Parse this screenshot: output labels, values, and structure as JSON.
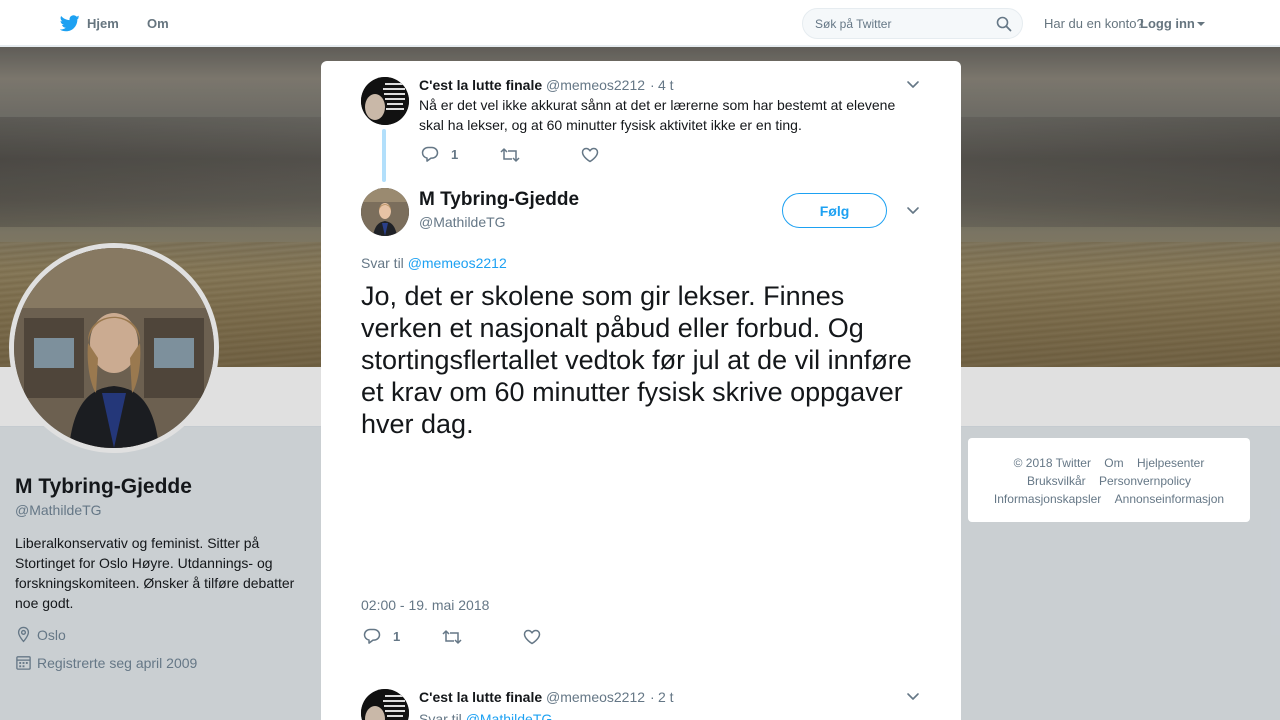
{
  "nav": {
    "home_label": "Hjem",
    "about_label": "Om",
    "search_placeholder": "Søk på Twitter",
    "account_prompt": "Har du en konto?",
    "login_label": "Logg inn"
  },
  "profile": {
    "name": "M Tybring-Gjedde",
    "handle": "@MathildeTG",
    "bio": "Liberalkonservativ og feminist. Sitter på Stortinget for Oslo Høyre. Utdannings- og forskningskomiteen. Ønsker å tilføre debatter noe godt.",
    "location": "Oslo",
    "joined": "Registrerte seg april 2009"
  },
  "footer": {
    "links": [
      "© 2018 Twitter",
      "Om",
      "Hjelpesenter",
      "Bruksvilkår",
      "Personvernpolicy",
      "Informasjonskapsler",
      "Annonseinformasjon"
    ]
  },
  "modal": {
    "parent_tweet": {
      "name": "C'est la lutte finale",
      "handle": "@memeos2212",
      "dot": "·",
      "time": "4 t",
      "text": "Nå er det vel ikke akkurat sånn at det er lærerne som har bestemt at elevene skal ha lekser, og at 60 minutter fysisk aktivitet ikke er en ting.",
      "reply_count": "1"
    },
    "main_tweet": {
      "name": "M Tybring-Gjedde",
      "handle": "@MathildeTG",
      "follow_label": "Følg",
      "reply_prefix": "Svar til",
      "reply_mention": "@memeos2212",
      "text": "Jo, det er skolene som gir lekser. Finnes verken et nasjonalt påbud eller forbud. Og stortingsflertallet vedtok før jul at de vil innføre et krav om 60 minutter fysisk skrive oppgaver hver dag.",
      "timestamp": "02:00 - 19. mai 2018",
      "reply_count": "1"
    },
    "next_tweet": {
      "name": "C'est la lutte finale",
      "handle": "@memeos2212",
      "dot": "·",
      "time": "2 t",
      "reply_prefix": "Svar til",
      "reply_mention": "@MathildeTG"
    }
  },
  "colors": {
    "accent": "#1da1f2",
    "text_secondary": "#657786",
    "background": "#e6ecf0"
  }
}
